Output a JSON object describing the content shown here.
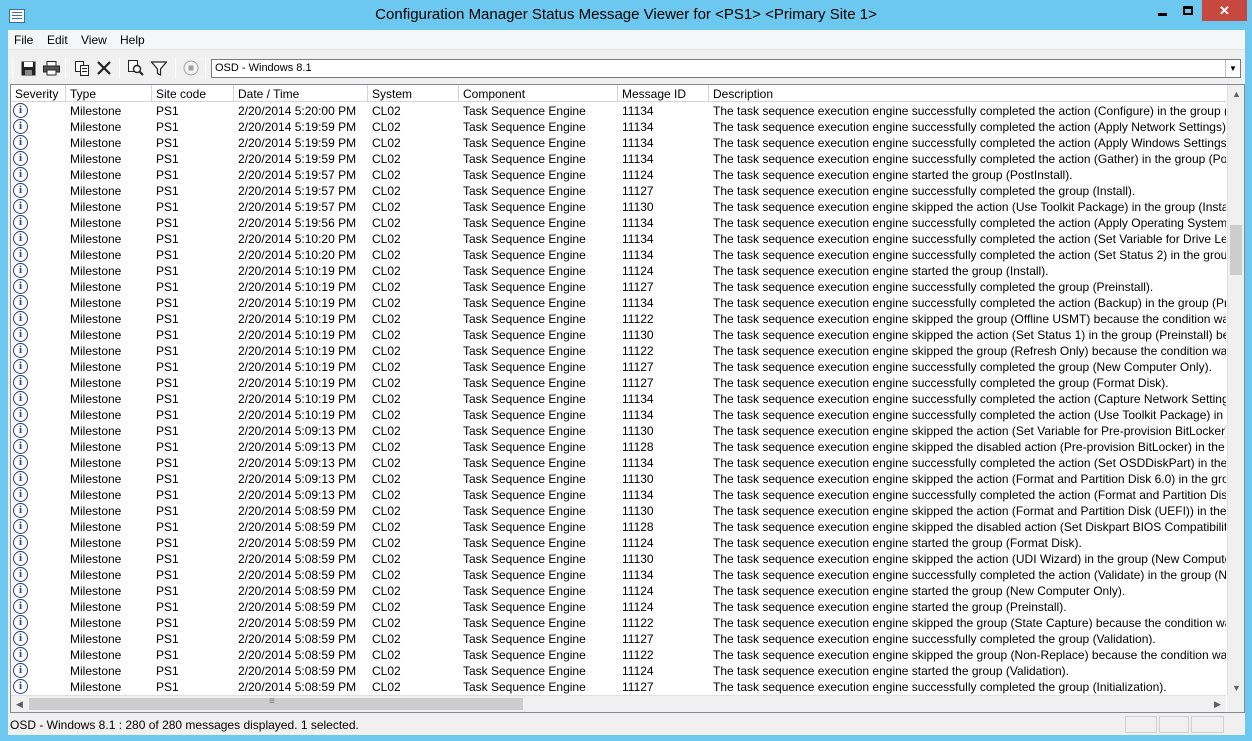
{
  "window": {
    "title": "Configuration Manager Status Message Viewer for <PS1> <Primary Site 1>",
    "close": "✕"
  },
  "menu": [
    {
      "label": "File"
    },
    {
      "label": "Edit"
    },
    {
      "label": "View"
    },
    {
      "label": "Help"
    }
  ],
  "toolbar": {
    "icons": [
      "save-icon",
      "print-icon",
      "copy-icon",
      "delete-icon",
      "find-icon",
      "filter-icon",
      "stop-icon"
    ],
    "query": "OSD - Windows 8.1",
    "dropdown_arrow": "▼"
  },
  "columns": [
    {
      "label": "Severity"
    },
    {
      "label": "Type"
    },
    {
      "label": "Site code"
    },
    {
      "label": "Date / Time"
    },
    {
      "label": "System"
    },
    {
      "label": "Component"
    },
    {
      "label": "Message ID"
    },
    {
      "label": "Description"
    }
  ],
  "rows": [
    {
      "severity": "i",
      "type": "Milestone",
      "site": "PS1",
      "datetime": "2/20/2014 5:20:00 PM",
      "system": "CL02",
      "component": "Task Sequence Engine",
      "msgid": "11134",
      "desc": "The task sequence execution engine successfully completed the action (Configure) in the group (I"
    },
    {
      "severity": "i",
      "type": "Milestone",
      "site": "PS1",
      "datetime": "2/20/2014 5:19:59 PM",
      "system": "CL02",
      "component": "Task Sequence Engine",
      "msgid": "11134",
      "desc": "The task sequence execution engine successfully completed the action (Apply Network Settings) i"
    },
    {
      "severity": "i",
      "type": "Milestone",
      "site": "PS1",
      "datetime": "2/20/2014 5:19:59 PM",
      "system": "CL02",
      "component": "Task Sequence Engine",
      "msgid": "11134",
      "desc": "The task sequence execution engine successfully completed the action (Apply Windows Settings)"
    },
    {
      "severity": "i",
      "type": "Milestone",
      "site": "PS1",
      "datetime": "2/20/2014 5:19:59 PM",
      "system": "CL02",
      "component": "Task Sequence Engine",
      "msgid": "11134",
      "desc": "The task sequence execution engine successfully completed the action (Gather) in the group (Post"
    },
    {
      "severity": "i",
      "type": "Milestone",
      "site": "PS1",
      "datetime": "2/20/2014 5:19:57 PM",
      "system": "CL02",
      "component": "Task Sequence Engine",
      "msgid": "11124",
      "desc": "The task sequence execution engine started the group (PostInstall)."
    },
    {
      "severity": "i",
      "type": "Milestone",
      "site": "PS1",
      "datetime": "2/20/2014 5:19:57 PM",
      "system": "CL02",
      "component": "Task Sequence Engine",
      "msgid": "11127",
      "desc": "The task sequence execution engine successfully completed the group (Install)."
    },
    {
      "severity": "i",
      "type": "Milestone",
      "site": "PS1",
      "datetime": "2/20/2014 5:19:57 PM",
      "system": "CL02",
      "component": "Task Sequence Engine",
      "msgid": "11130",
      "desc": "The task sequence execution engine skipped the action (Use Toolkit Package) in the group (Install"
    },
    {
      "severity": "i",
      "type": "Milestone",
      "site": "PS1",
      "datetime": "2/20/2014 5:19:56 PM",
      "system": "CL02",
      "component": "Task Sequence Engine",
      "msgid": "11134",
      "desc": "The task sequence execution engine successfully completed the action (Apply Operating System I"
    },
    {
      "severity": "i",
      "type": "Milestone",
      "site": "PS1",
      "datetime": "2/20/2014 5:10:20 PM",
      "system": "CL02",
      "component": "Task Sequence Engine",
      "msgid": "11134",
      "desc": "The task sequence execution engine successfully completed the action (Set Variable for Drive Lette"
    },
    {
      "severity": "i",
      "type": "Milestone",
      "site": "PS1",
      "datetime": "2/20/2014 5:10:20 PM",
      "system": "CL02",
      "component": "Task Sequence Engine",
      "msgid": "11134",
      "desc": "The task sequence execution engine successfully completed the action (Set Status 2) in the group"
    },
    {
      "severity": "i",
      "type": "Milestone",
      "site": "PS1",
      "datetime": "2/20/2014 5:10:19 PM",
      "system": "CL02",
      "component": "Task Sequence Engine",
      "msgid": "11124",
      "desc": "The task sequence execution engine started the group (Install)."
    },
    {
      "severity": "i",
      "type": "Milestone",
      "site": "PS1",
      "datetime": "2/20/2014 5:10:19 PM",
      "system": "CL02",
      "component": "Task Sequence Engine",
      "msgid": "11127",
      "desc": "The task sequence execution engine successfully completed the group (Preinstall)."
    },
    {
      "severity": "i",
      "type": "Milestone",
      "site": "PS1",
      "datetime": "2/20/2014 5:10:19 PM",
      "system": "CL02",
      "component": "Task Sequence Engine",
      "msgid": "11134",
      "desc": "The task sequence execution engine successfully completed the action (Backup) in the group (Pre"
    },
    {
      "severity": "i",
      "type": "Milestone",
      "site": "PS1",
      "datetime": "2/20/2014 5:10:19 PM",
      "system": "CL02",
      "component": "Task Sequence Engine",
      "msgid": "11122",
      "desc": "The task sequence execution engine skipped the group (Offline USMT) because the condition was"
    },
    {
      "severity": "i",
      "type": "Milestone",
      "site": "PS1",
      "datetime": "2/20/2014 5:10:19 PM",
      "system": "CL02",
      "component": "Task Sequence Engine",
      "msgid": "11130",
      "desc": "The task sequence execution engine skipped the action (Set Status 1) in the group (Preinstall) beca"
    },
    {
      "severity": "i",
      "type": "Milestone",
      "site": "PS1",
      "datetime": "2/20/2014 5:10:19 PM",
      "system": "CL02",
      "component": "Task Sequence Engine",
      "msgid": "11122",
      "desc": "The task sequence execution engine skipped the group (Refresh Only) because the condition was"
    },
    {
      "severity": "i",
      "type": "Milestone",
      "site": "PS1",
      "datetime": "2/20/2014 5:10:19 PM",
      "system": "CL02",
      "component": "Task Sequence Engine",
      "msgid": "11127",
      "desc": "The task sequence execution engine successfully completed the group (New Computer Only)."
    },
    {
      "severity": "i",
      "type": "Milestone",
      "site": "PS1",
      "datetime": "2/20/2014 5:10:19 PM",
      "system": "CL02",
      "component": "Task Sequence Engine",
      "msgid": "11127",
      "desc": "The task sequence execution engine successfully completed the group (Format Disk)."
    },
    {
      "severity": "i",
      "type": "Milestone",
      "site": "PS1",
      "datetime": "2/20/2014 5:10:19 PM",
      "system": "CL02",
      "component": "Task Sequence Engine",
      "msgid": "11134",
      "desc": "The task sequence execution engine successfully completed the action (Capture Network Settings"
    },
    {
      "severity": "i",
      "type": "Milestone",
      "site": "PS1",
      "datetime": "2/20/2014 5:10:19 PM",
      "system": "CL02",
      "component": "Task Sequence Engine",
      "msgid": "11134",
      "desc": "The task sequence execution engine successfully completed the action (Use Toolkit Package) in th"
    },
    {
      "severity": "i",
      "type": "Milestone",
      "site": "PS1",
      "datetime": "2/20/2014 5:09:13 PM",
      "system": "CL02",
      "component": "Task Sequence Engine",
      "msgid": "11130",
      "desc": "The task sequence execution engine skipped the action (Set Variable for Pre-provision BitLocker) i"
    },
    {
      "severity": "i",
      "type": "Milestone",
      "site": "PS1",
      "datetime": "2/20/2014 5:09:13 PM",
      "system": "CL02",
      "component": "Task Sequence Engine",
      "msgid": "11128",
      "desc": "The task sequence execution engine skipped the disabled action (Pre-provision BitLocker) in the g"
    },
    {
      "severity": "i",
      "type": "Milestone",
      "site": "PS1",
      "datetime": "2/20/2014 5:09:13 PM",
      "system": "CL02",
      "component": "Task Sequence Engine",
      "msgid": "11134",
      "desc": "The task sequence execution engine successfully completed the action (Set OSDDiskPart) in the g"
    },
    {
      "severity": "i",
      "type": "Milestone",
      "site": "PS1",
      "datetime": "2/20/2014 5:09:13 PM",
      "system": "CL02",
      "component": "Task Sequence Engine",
      "msgid": "11130",
      "desc": "The task sequence execution engine skipped the action (Format and Partition Disk 6.0) in the grou"
    },
    {
      "severity": "i",
      "type": "Milestone",
      "site": "PS1",
      "datetime": "2/20/2014 5:09:13 PM",
      "system": "CL02",
      "component": "Task Sequence Engine",
      "msgid": "11134",
      "desc": "The task sequence execution engine successfully completed the action (Format and Partition Disk"
    },
    {
      "severity": "i",
      "type": "Milestone",
      "site": "PS1",
      "datetime": "2/20/2014 5:08:59 PM",
      "system": "CL02",
      "component": "Task Sequence Engine",
      "msgid": "11130",
      "desc": "The task sequence execution engine skipped the action (Format and Partition Disk (UEFI)) in the g"
    },
    {
      "severity": "i",
      "type": "Milestone",
      "site": "PS1",
      "datetime": "2/20/2014 5:08:59 PM",
      "system": "CL02",
      "component": "Task Sequence Engine",
      "msgid": "11128",
      "desc": "The task sequence execution engine skipped the disabled action (Set Diskpart BIOS Compatibility"
    },
    {
      "severity": "i",
      "type": "Milestone",
      "site": "PS1",
      "datetime": "2/20/2014 5:08:59 PM",
      "system": "CL02",
      "component": "Task Sequence Engine",
      "msgid": "11124",
      "desc": "The task sequence execution engine started the group (Format Disk)."
    },
    {
      "severity": "i",
      "type": "Milestone",
      "site": "PS1",
      "datetime": "2/20/2014 5:08:59 PM",
      "system": "CL02",
      "component": "Task Sequence Engine",
      "msgid": "11130",
      "desc": "The task sequence execution engine skipped the action (UDI Wizard) in the group (New Compute"
    },
    {
      "severity": "i",
      "type": "Milestone",
      "site": "PS1",
      "datetime": "2/20/2014 5:08:59 PM",
      "system": "CL02",
      "component": "Task Sequence Engine",
      "msgid": "11134",
      "desc": "The task sequence execution engine successfully completed the action (Validate) in the group (Ne"
    },
    {
      "severity": "i",
      "type": "Milestone",
      "site": "PS1",
      "datetime": "2/20/2014 5:08:59 PM",
      "system": "CL02",
      "component": "Task Sequence Engine",
      "msgid": "11124",
      "desc": "The task sequence execution engine started the group (New Computer Only)."
    },
    {
      "severity": "i",
      "type": "Milestone",
      "site": "PS1",
      "datetime": "2/20/2014 5:08:59 PM",
      "system": "CL02",
      "component": "Task Sequence Engine",
      "msgid": "11124",
      "desc": "The task sequence execution engine started the group (Preinstall)."
    },
    {
      "severity": "i",
      "type": "Milestone",
      "site": "PS1",
      "datetime": "2/20/2014 5:08:59 PM",
      "system": "CL02",
      "component": "Task Sequence Engine",
      "msgid": "11122",
      "desc": "The task sequence execution engine skipped the group (State Capture) because the condition was"
    },
    {
      "severity": "i",
      "type": "Milestone",
      "site": "PS1",
      "datetime": "2/20/2014 5:08:59 PM",
      "system": "CL02",
      "component": "Task Sequence Engine",
      "msgid": "11127",
      "desc": "The task sequence execution engine successfully completed the group (Validation)."
    },
    {
      "severity": "i",
      "type": "Milestone",
      "site": "PS1",
      "datetime": "2/20/2014 5:08:59 PM",
      "system": "CL02",
      "component": "Task Sequence Engine",
      "msgid": "11122",
      "desc": "The task sequence execution engine skipped the group (Non-Replace) because the condition was"
    },
    {
      "severity": "i",
      "type": "Milestone",
      "site": "PS1",
      "datetime": "2/20/2014 5:08:59 PM",
      "system": "CL02",
      "component": "Task Sequence Engine",
      "msgid": "11124",
      "desc": "The task sequence execution engine started the group (Validation)."
    },
    {
      "severity": "i",
      "type": "Milestone",
      "site": "PS1",
      "datetime": "2/20/2014 5:08:59 PM",
      "system": "CL02",
      "component": "Task Sequence Engine",
      "msgid": "11127",
      "desc": "The task sequence execution engine successfully completed the group (Initialization)."
    }
  ],
  "status": {
    "text": "OSD - Windows 8.1 : 280 of 280 messages displayed. 1 selected."
  },
  "scroll": {
    "up": "▲",
    "down": "▼",
    "left": "◀",
    "right": "▶",
    "grip": "≡"
  },
  "colors": {
    "titlebar": "#6cc8ee",
    "close_button": "#c7483f",
    "info_icon": "#1f3f8c"
  }
}
